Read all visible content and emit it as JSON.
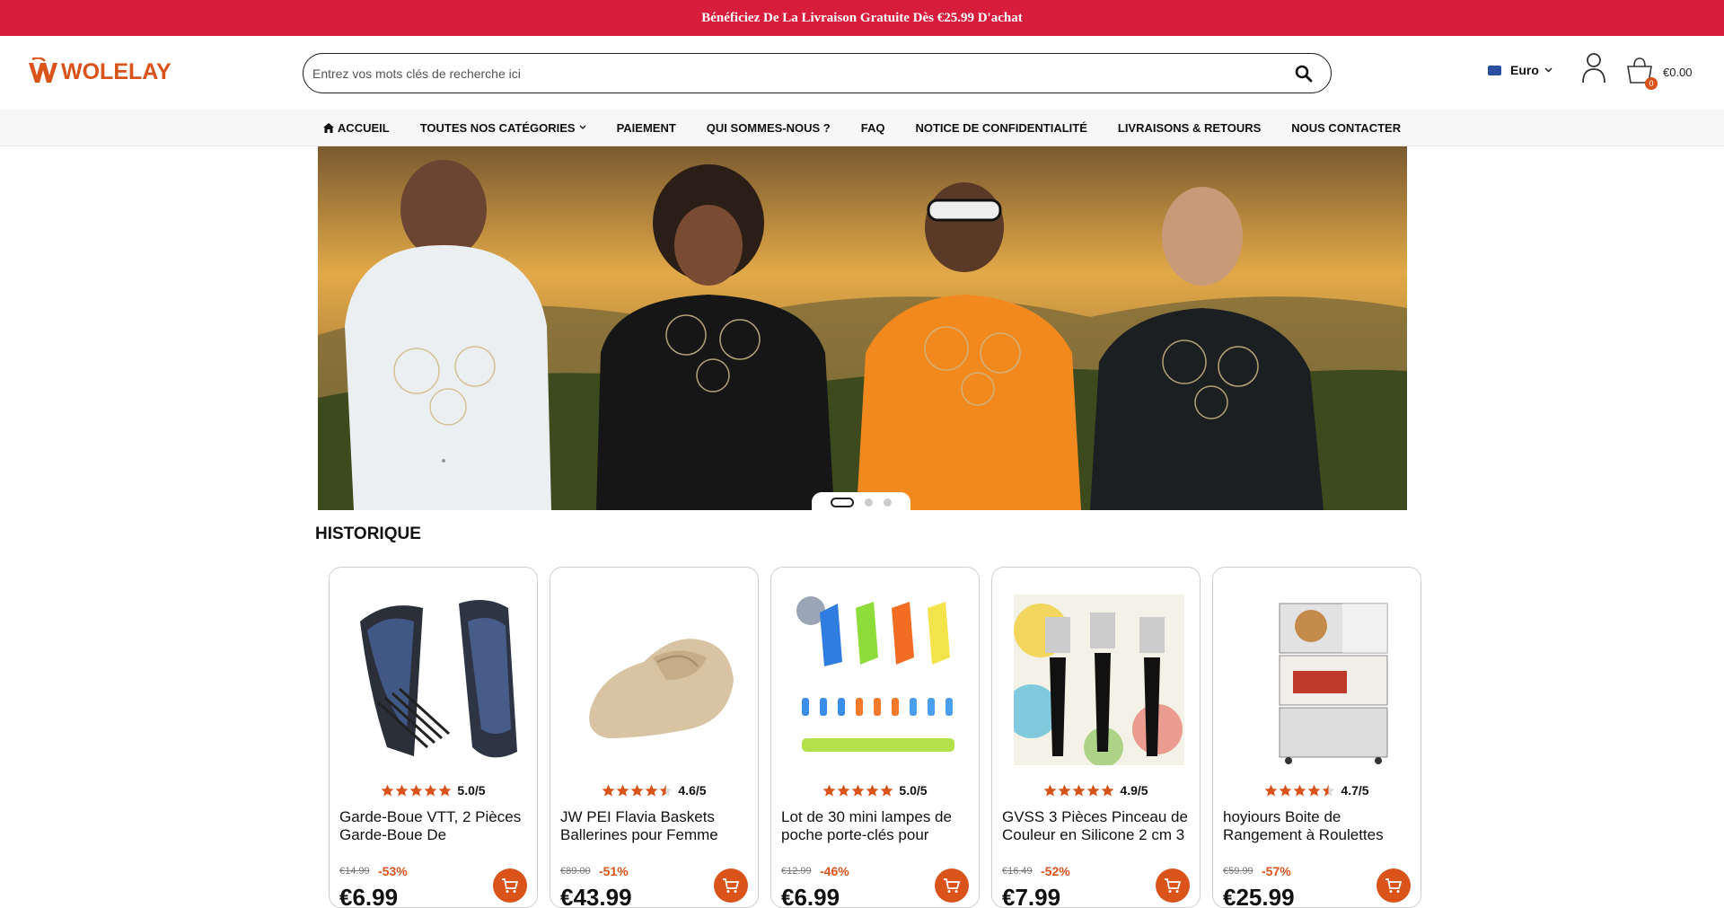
{
  "promo": {
    "text": "Bénéficiez De La Livraison Gratuite Dès €25.99 D'achat"
  },
  "header": {
    "logo_text": "WOLELAY",
    "search_placeholder": "Entrez vos mots clés de recherche ici",
    "currency_label": "Euro",
    "cart_count": "0",
    "cart_total": "€0.00"
  },
  "nav": {
    "items": [
      {
        "label": "ACCUEIL",
        "icon": "home-icon"
      },
      {
        "label": "TOUTES NOS CATÉGORIES",
        "icon": "chevron-down-icon"
      },
      {
        "label": "PAIEMENT"
      },
      {
        "label": "QUI SOMMES-NOUS ?"
      },
      {
        "label": "FAQ"
      },
      {
        "label": "NOTICE DE CONFIDENTIALITÉ"
      },
      {
        "label": "LIVRAISONS & RETOURS"
      },
      {
        "label": "NOUS CONTACTER"
      }
    ]
  },
  "section": {
    "title": "HISTORIQUE"
  },
  "products": [
    {
      "rating": "5.0/5",
      "stars": 5,
      "title": "Garde-Boue VTT, 2 Pièces Garde-Boue De",
      "old_price": "€14.99",
      "discount": "-53%",
      "price": "€6.99"
    },
    {
      "rating": "4.6/5",
      "stars": 4.5,
      "title": "JW PEI Flavia Baskets Ballerines pour Femme",
      "old_price": "€89.00",
      "discount": "-51%",
      "price": "€43.99"
    },
    {
      "rating": "5.0/5",
      "stars": 5,
      "title": "Lot de 30 mini lampes de poche porte-clés pour",
      "old_price": "€12.99",
      "discount": "-46%",
      "price": "€6.99"
    },
    {
      "rating": "4.9/5",
      "stars": 5,
      "title": "GVSS 3 Pièces Pinceau de Couleur en Silicone 2 cm 3",
      "old_price": "€16.49",
      "discount": "-52%",
      "price": "€7.99"
    },
    {
      "rating": "4.7/5",
      "stars": 4.5,
      "title": "hoyiours Boite de Rangement à Roulettes",
      "old_price": "€59.99",
      "discount": "-57%",
      "price": "€25.99"
    }
  ],
  "colors": {
    "promo_bg": "#d81d3c",
    "accent": "#d9531b"
  }
}
